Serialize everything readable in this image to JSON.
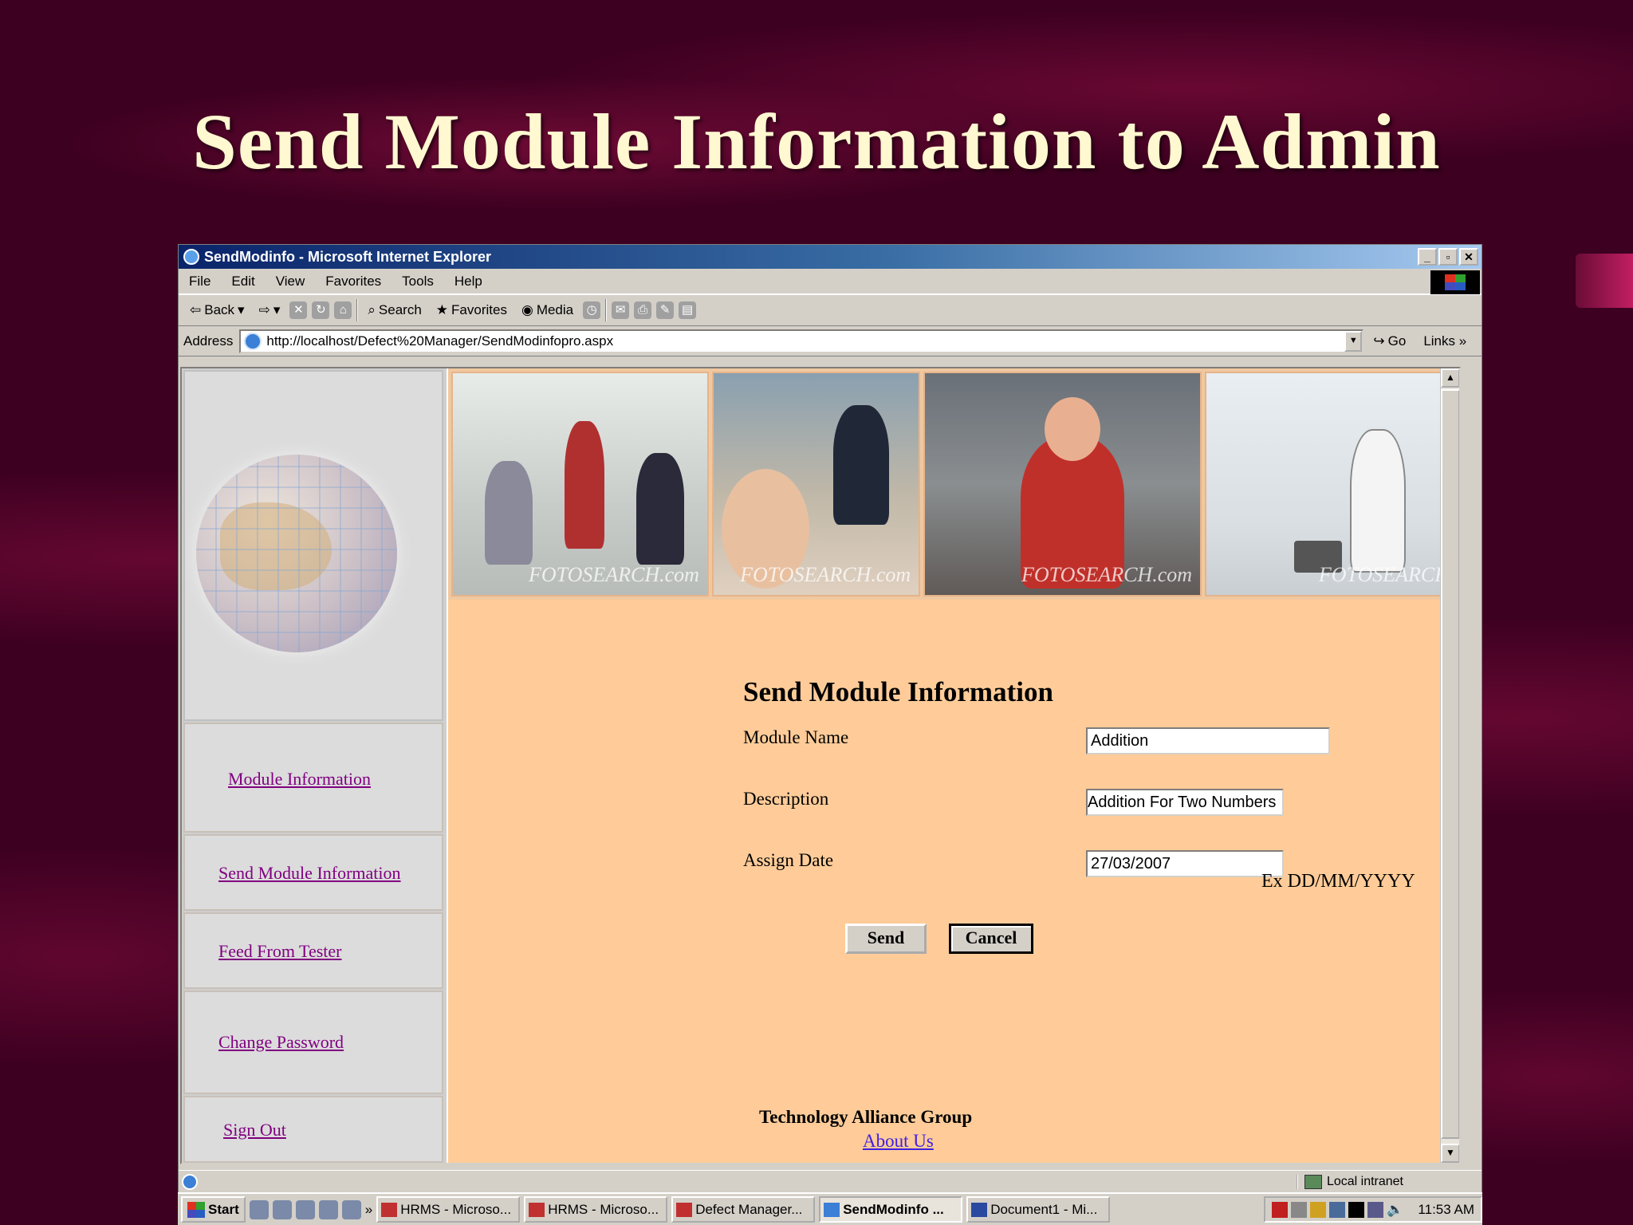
{
  "slide_title": "Send Module Information to Admin",
  "browser": {
    "title": "SendModinfo - Microsoft Internet Explorer",
    "window_buttons": [
      "_",
      "▫",
      "✕"
    ],
    "menu": [
      "File",
      "Edit",
      "View",
      "Favorites",
      "Tools",
      "Help"
    ],
    "toolbar": {
      "back": "Back",
      "search": "Search",
      "favorites": "Favorites",
      "media": "Media"
    },
    "address_label": "Address",
    "address_url": "http://localhost/Defect%20Manager/SendModinfopro.aspx",
    "go_label": "Go",
    "links_label": "Links",
    "links_chevron": "»",
    "status_zone": "Local intranet"
  },
  "sidebar": {
    "nav": [
      {
        "label": "Module Information"
      },
      {
        "label": "Send Module Information"
      },
      {
        "label": "Feed From Tester"
      },
      {
        "label": "Change Password"
      },
      {
        "label": "Sign Out"
      }
    ]
  },
  "banner": {
    "watermarks": [
      "FOTOSEARCH.com",
      "FOTOSEARCH.com",
      "FOTOSEARCH.com",
      "FOTOSEARCH"
    ]
  },
  "form": {
    "title": "Send Module Information",
    "module_name_label": "Module Name",
    "module_name_value": "Addition",
    "description_label": "Description",
    "description_value": "Addition For Two Numbers",
    "assign_date_label": "Assign Date",
    "assign_date_value": "27/03/2007",
    "date_hint": "Ex DD/MM/YYYY",
    "send_label": "Send",
    "cancel_label": "Cancel"
  },
  "footer": {
    "org": "Technology Alliance Group",
    "about_link": "About Us"
  },
  "taskbar": {
    "start_label": "Start",
    "more": "»",
    "tasks": [
      "HRMS - Microso...",
      "HRMS - Microso...",
      "Defect Manager...",
      "SendModinfo ...",
      "Document1 - Mi..."
    ],
    "active_task_index": 3,
    "clock": "11:53 AM"
  },
  "colors": {
    "slide_bg": "#3d0020",
    "title": "#fff8d0",
    "content_bg": "#ffcc99",
    "visited_link": "#800080"
  }
}
